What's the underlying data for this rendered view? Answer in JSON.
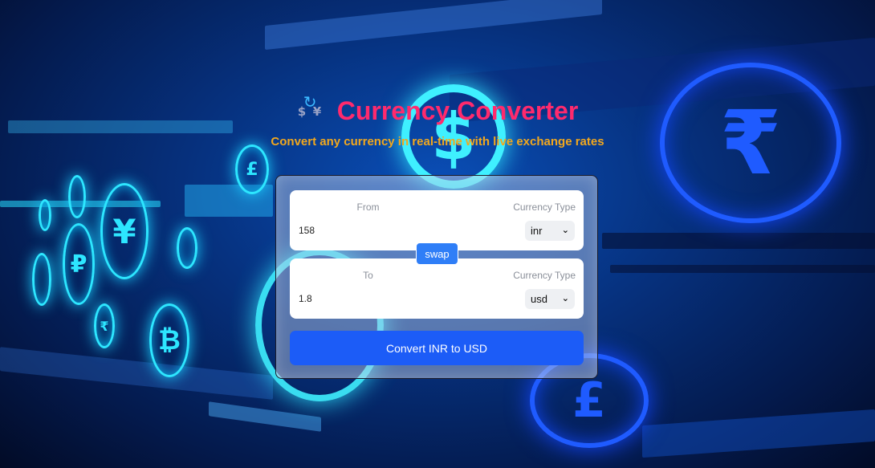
{
  "header": {
    "title": "Currency Converter",
    "subtitle": "Convert any currency in real-time with live exchange rates",
    "logo_icon": "currency-exchange-icon",
    "logo_symbols": [
      "$",
      "¥"
    ]
  },
  "from": {
    "label": "From",
    "type_label": "Currency Type",
    "amount": "158",
    "currency": "inr"
  },
  "to": {
    "label": "To",
    "type_label": "Currency Type",
    "amount": "1.8",
    "currency": "usd"
  },
  "swap_label": "swap",
  "convert_label": "Convert INR to USD",
  "background": {
    "coin_symbols": [
      "₹",
      "$",
      "£",
      "¥",
      "₽",
      "₿",
      "£",
      "₹"
    ]
  },
  "colors": {
    "title": "#ff2a6d",
    "subtitle": "#f2a81d",
    "primary_button": "#1c5cf7",
    "swap_button": "#2f7ef7"
  }
}
